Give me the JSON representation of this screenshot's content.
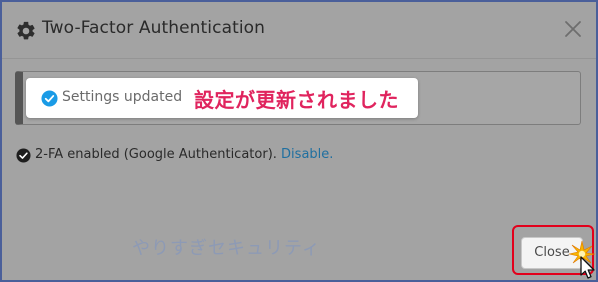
{
  "modal": {
    "title": "Two-Factor Authentication",
    "title_icon": "gear-icon",
    "close_icon": "close-x-icon"
  },
  "toast": {
    "message": "Settings updated",
    "annotation_jp": "設定が更新されました",
    "icon": "check-circle-icon",
    "accent_color": "#1a9be6",
    "annotation_color": "#e0245e"
  },
  "twofa": {
    "status_text": "2-FA enabled (Google Authenticator).",
    "disable_link": "Disable.",
    "icon": "check-circle-icon"
  },
  "watermark": "やりすぎセキュリティ",
  "footer": {
    "close_label": "Close",
    "highlight_color": "#e3001b"
  }
}
